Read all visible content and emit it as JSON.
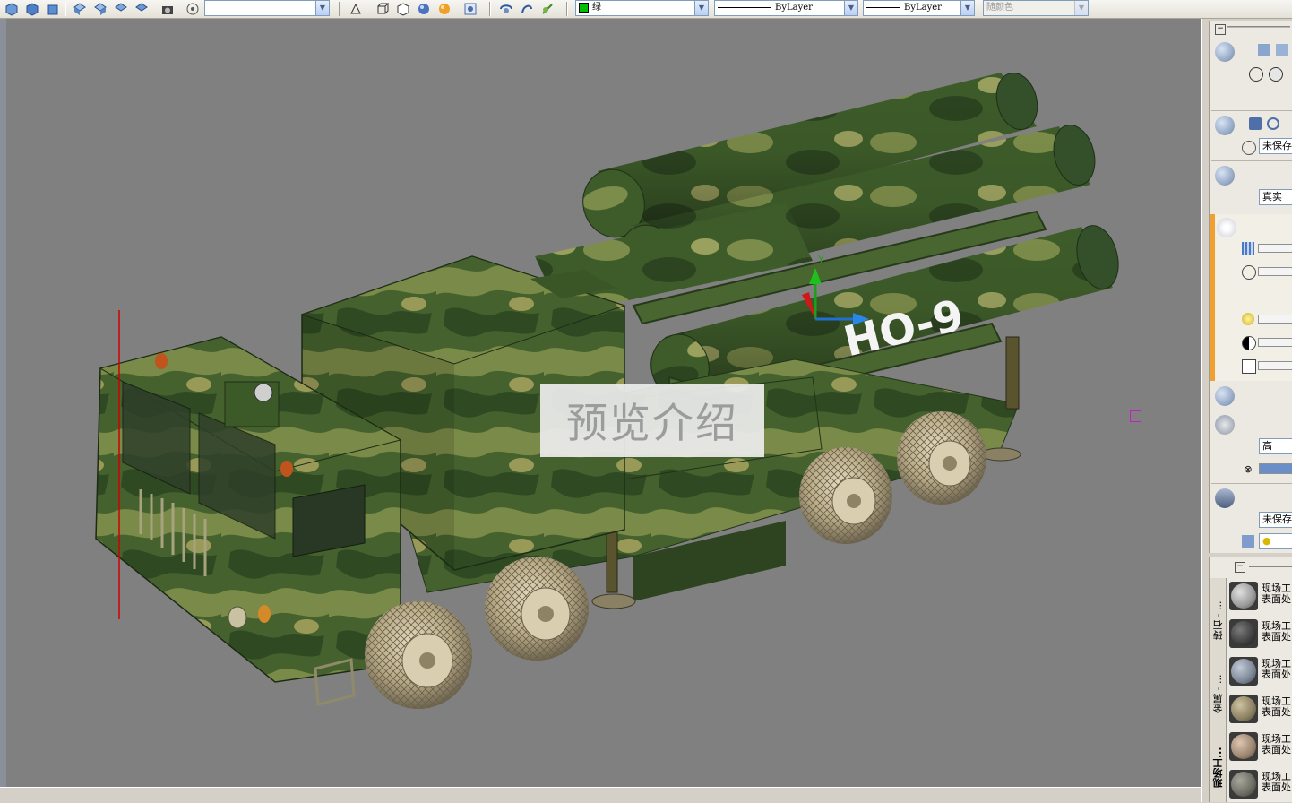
{
  "toolbar": {
    "layer_color": "绿",
    "linetype": "ByLayer",
    "lineweight": "ByLayer",
    "plot_style": "随颜色"
  },
  "viewport": {
    "preview_label": "预览介绍",
    "missile_marking": "HQ-9",
    "ucs_y_label": "Y"
  },
  "dashboard": {
    "named_view": "未保存",
    "visual_style": "真实",
    "render_quality": "高",
    "named_layer_state": "未保存"
  },
  "materials": {
    "tabs": [
      "砖石 - ...",
      "金属 - ...",
      "现场工..."
    ],
    "items": [
      {
        "line1": "现场工",
        "line2": "表面处",
        "tone": "#9a9a9a"
      },
      {
        "line1": "现场工",
        "line2": "表面处",
        "tone": "#3d3d3d"
      },
      {
        "line1": "现场工",
        "line2": "表面处",
        "tone": "#7c8796"
      },
      {
        "line1": "现场工",
        "line2": "表面处",
        "tone": "#8a8062"
      },
      {
        "line1": "现场工",
        "line2": "表面处",
        "tone": "#9b8570"
      },
      {
        "line1": "现场工",
        "line2": "表面处",
        "tone": "#6c6c64"
      }
    ]
  }
}
